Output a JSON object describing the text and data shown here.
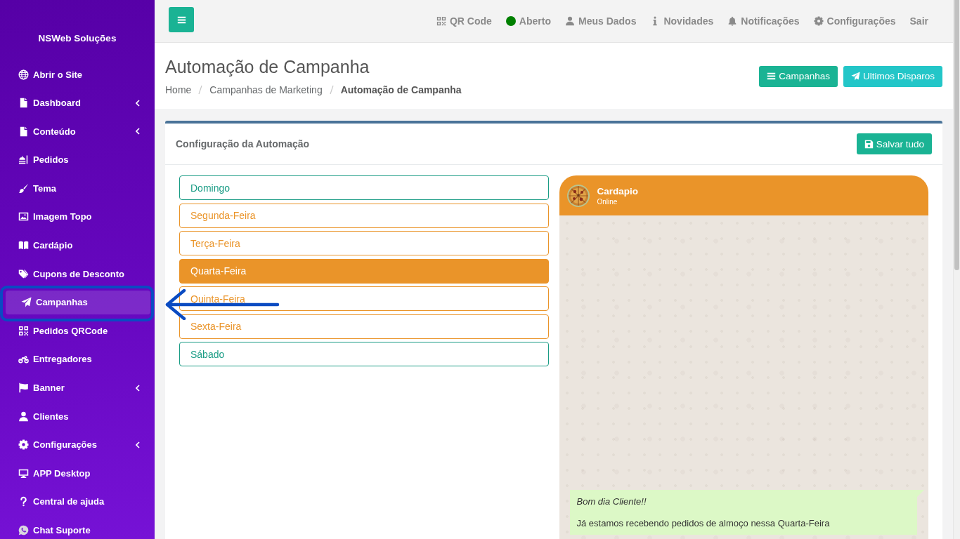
{
  "sidebar": {
    "brand": "NSWeb Soluções",
    "items": [
      {
        "label": "Abrir o Site",
        "selected": false,
        "submenu": false
      },
      {
        "label": "Dashboard",
        "selected": false,
        "submenu": true
      },
      {
        "label": "Conteúdo",
        "selected": false,
        "submenu": true
      },
      {
        "label": "Pedidos",
        "selected": false,
        "submenu": false
      },
      {
        "label": "Tema",
        "selected": false,
        "submenu": false
      },
      {
        "label": "Imagem Topo",
        "selected": false,
        "submenu": false
      },
      {
        "label": "Cardápio",
        "selected": false,
        "submenu": false
      },
      {
        "label": "Cupons de Desconto",
        "selected": false,
        "submenu": false
      },
      {
        "label": "Campanhas",
        "selected": true,
        "submenu": false
      },
      {
        "label": "Pedidos QRCode",
        "selected": false,
        "submenu": false
      },
      {
        "label": "Entregadores",
        "selected": false,
        "submenu": false
      },
      {
        "label": "Banner",
        "selected": false,
        "submenu": true
      },
      {
        "label": "Clientes",
        "selected": false,
        "submenu": false
      },
      {
        "label": "Configurações",
        "selected": false,
        "submenu": true
      },
      {
        "label": "APP Desktop",
        "selected": false,
        "submenu": false
      },
      {
        "label": "Central de ajuda",
        "selected": false,
        "submenu": false
      },
      {
        "label": "Chat Suporte",
        "selected": false,
        "submenu": false
      }
    ]
  },
  "topbar": {
    "nav": [
      {
        "label": "QR Code"
      },
      {
        "label": "Aberto",
        "color": "#008000"
      },
      {
        "label": "Meus Dados"
      },
      {
        "label": "Novidades"
      },
      {
        "label": "Notificações"
      },
      {
        "label": "Configurações"
      },
      {
        "label": "Sair"
      }
    ]
  },
  "header": {
    "title": "Automação de Campanha",
    "breadcrumb": [
      {
        "label": "Home",
        "current": false
      },
      {
        "label": "Campanhas de Marketing",
        "current": false
      },
      {
        "label": "Automação de Campanha",
        "current": true
      }
    ],
    "buttons": [
      {
        "label": "Campanhas",
        "kind": "primary"
      },
      {
        "label": "Ultimos Disparos",
        "kind": "info"
      }
    ]
  },
  "card": {
    "title": "Configuração da Automação",
    "save_button": "Salvar tudo",
    "days": [
      {
        "label": "Domingo",
        "selected": false,
        "color": "#1a9c85"
      },
      {
        "label": "Segunda-Feira",
        "selected": false,
        "color": "#ea9429"
      },
      {
        "label": "Terça-Feira",
        "selected": false,
        "color": "#ea9429"
      },
      {
        "label": "Quarta-Feira",
        "selected": true,
        "color": "#ea9429"
      },
      {
        "label": "Quinta-Feira",
        "selected": false,
        "color": "#ea9429"
      },
      {
        "label": "Sexta-Feira",
        "selected": false,
        "color": "#ea9429"
      },
      {
        "label": "Sábado",
        "selected": false,
        "color": "#1a9c85"
      }
    ],
    "preview": {
      "name": "Cardapio",
      "status": "Online",
      "message": [
        {
          "text": "Bom dia Cliente!!",
          "italic": true
        },
        {
          "text": "Já estamos recebendo pedidos de almoço nessa Quarta-Feira",
          "italic": false
        }
      ]
    }
  }
}
